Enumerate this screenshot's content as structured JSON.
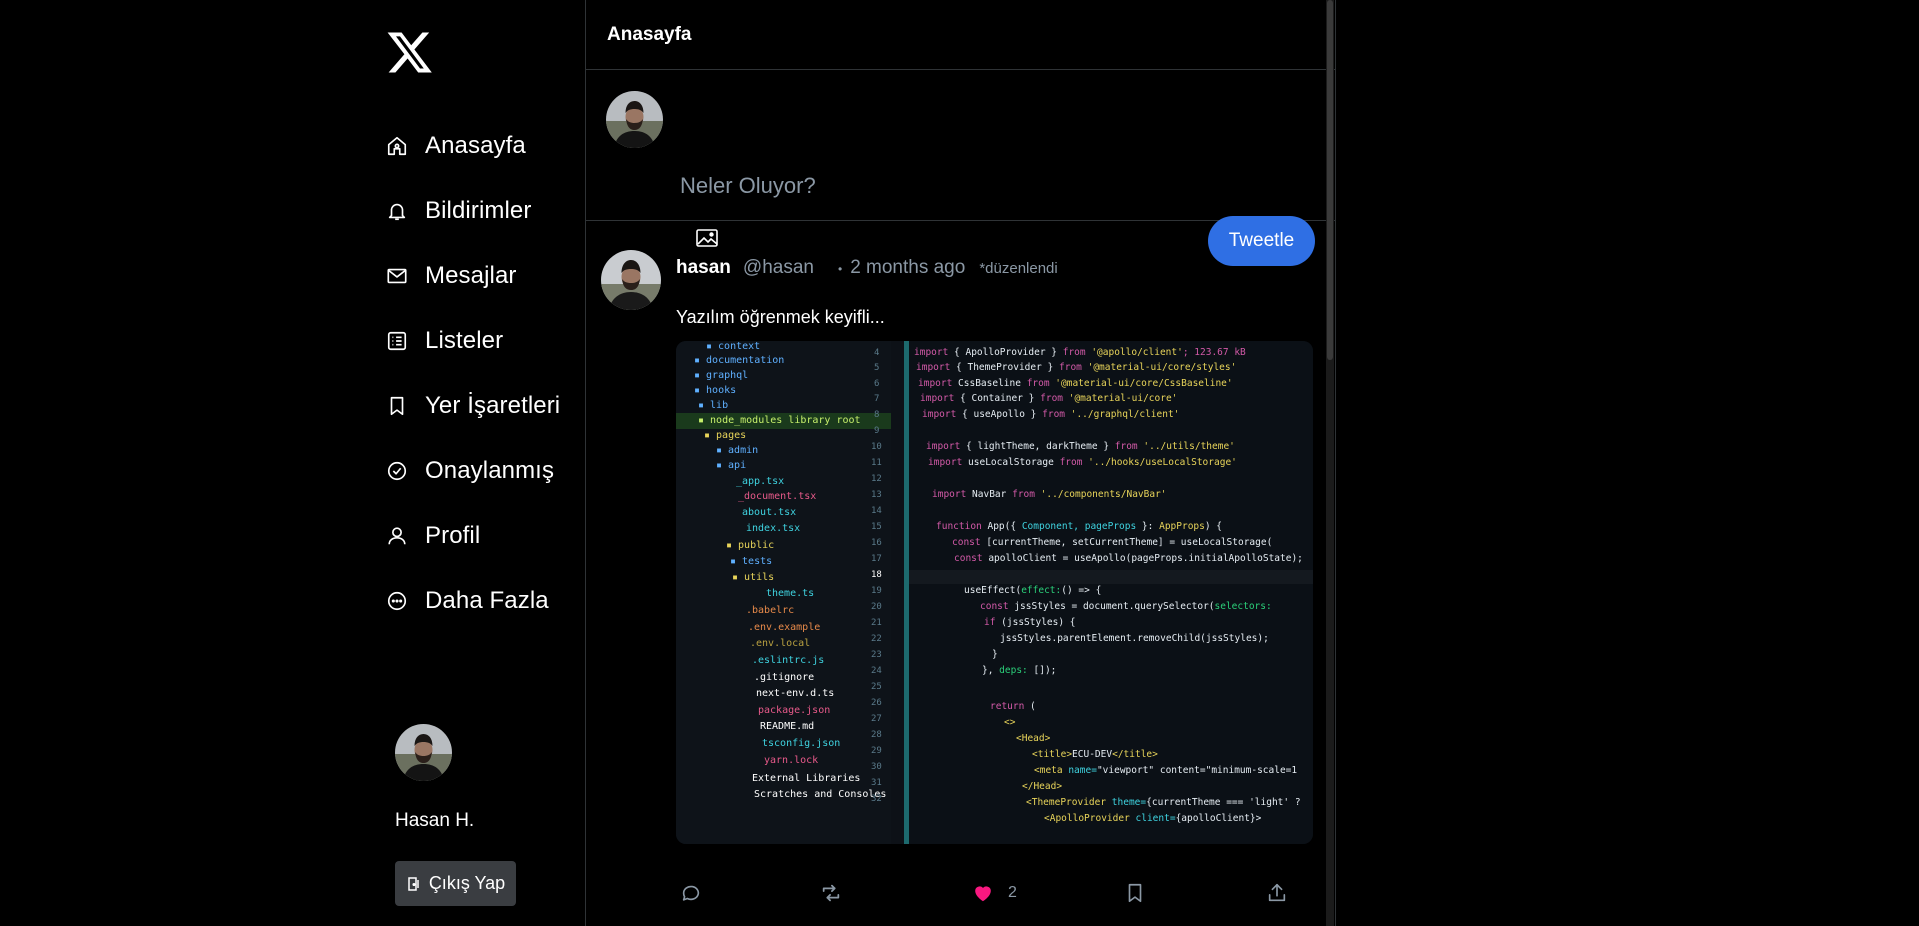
{
  "sidebar": {
    "logo_icon": "x-logo-icon",
    "items": [
      {
        "label": "Anasayfa",
        "icon": "home-icon"
      },
      {
        "label": "Bildirimler",
        "icon": "bell-icon"
      },
      {
        "label": "Mesajlar",
        "icon": "mail-icon"
      },
      {
        "label": "Listeler",
        "icon": "list-icon"
      },
      {
        "label": "Yer İşaretleri",
        "icon": "bookmark-icon"
      },
      {
        "label": "Onaylanmış",
        "icon": "check-circle-icon"
      },
      {
        "label": "Profil",
        "icon": "user-icon"
      },
      {
        "label": "Daha Fazla",
        "icon": "more-circle-icon"
      }
    ],
    "user": {
      "name": "Hasan H."
    },
    "logout_label": "Çıkış Yap"
  },
  "main": {
    "header_title": "Anasayfa",
    "composer": {
      "placeholder": "Neler Oluyor?",
      "button_label": "Tweetle"
    },
    "post": {
      "author": "hasan",
      "handle": "@hasan",
      "separator": "•",
      "time": "2 months ago",
      "edited": "*düzenlendi",
      "text": "Yazılım öğrenmek keyifli...",
      "likes": "2",
      "liked": true
    }
  },
  "colors": {
    "accent": "#2f6fe4",
    "like": "#f91880",
    "muted": "#8b98a5"
  }
}
